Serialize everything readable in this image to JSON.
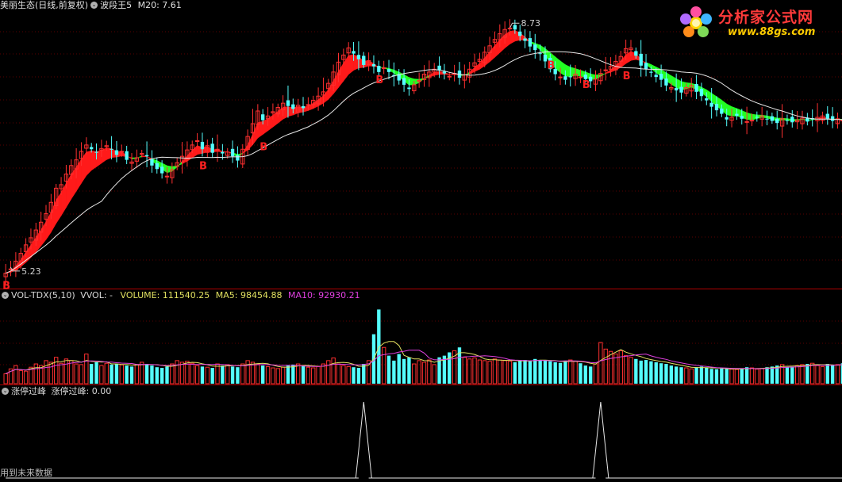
{
  "colors": {
    "bg": "#000000",
    "grid": "#5a0000",
    "up": "#ff3030",
    "down": "#54ffff",
    "band_up": "#ff1a1a",
    "band_down": "#22ff22",
    "ma": "#e8e8e8",
    "ma5": "#e0e060",
    "ma10": "#e040e0",
    "buy": "#ff2020",
    "divider": "#b00000"
  },
  "header": {
    "stock": "美丽生态",
    "period": "(日线,前复权)",
    "indicator": "波段王5",
    "ma_label": "M20: 7.61"
  },
  "price_panel": {
    "high_label": "8.73",
    "low_label": "5.23",
    "buy_marker": "B",
    "buy_indices": [
      0,
      39,
      51,
      74,
      108,
      115,
      123
    ]
  },
  "volume_panel": {
    "title": "VOL-TDX(5,10)",
    "vvol": "VVOL: -",
    "volume": "VOLUME: 111540.25",
    "ma5": "MA5: 98454.88",
    "ma10": "MA10: 92930.21"
  },
  "limit_panel": {
    "title": "涨停过峰",
    "value": "涨停过峰: 0.00",
    "peak_indices": [
      71,
      118
    ]
  },
  "footer": {
    "text": "用到未来数据"
  },
  "logo": {
    "name": "分析家公式网",
    "url": "www.88gs.com"
  },
  "chart_data": {
    "type": "candlestick",
    "low_label": 5.23,
    "high_label": 8.73,
    "closes": [
      5.2,
      5.26,
      5.37,
      5.48,
      5.6,
      5.7,
      5.81,
      5.92,
      6.04,
      6.2,
      6.4,
      6.45,
      6.6,
      6.72,
      6.8,
      6.92,
      7.01,
      6.95,
      6.9,
      6.96,
      7.0,
      6.95,
      6.87,
      6.92,
      6.8,
      6.77,
      6.83,
      6.89,
      6.85,
      6.72,
      6.67,
      6.61,
      6.57,
      6.66,
      6.76,
      6.85,
      6.94,
      7.01,
      7.07,
      6.95,
      7.0,
      6.9,
      6.95,
      6.89,
      6.91,
      6.85,
      6.79,
      6.95,
      7.13,
      7.31,
      7.49,
      7.36,
      7.42,
      7.48,
      7.54,
      7.6,
      7.56,
      7.52,
      7.57,
      7.53,
      7.58,
      7.64,
      7.7,
      7.76,
      7.88,
      8.04,
      8.18,
      8.28,
      8.38,
      8.3,
      8.22,
      8.14,
      8.2,
      8.12,
      8.04,
      8.1,
      8.04,
      7.98,
      7.92,
      7.86,
      7.8,
      7.86,
      7.92,
      8.01,
      8.04,
      8.08,
      8.06,
      8.02,
      7.98,
      8.02,
      7.96,
      8.0,
      8.08,
      8.17,
      8.22,
      8.32,
      8.41,
      8.5,
      8.58,
      8.64,
      8.66,
      8.64,
      8.55,
      8.48,
      8.4,
      8.35,
      8.3,
      8.19,
      8.08,
      8.01,
      7.97,
      7.93,
      7.97,
      8.01,
      7.97,
      7.94,
      7.91,
      7.94,
      8.02,
      8.07,
      8.12,
      8.19,
      8.26,
      8.37,
      8.38,
      8.27,
      8.13,
      8.08,
      8.03,
      7.97,
      7.93,
      7.85,
      7.82,
      7.78,
      7.75,
      7.82,
      7.85,
      7.76,
      7.7,
      7.64,
      7.55,
      7.5,
      7.45,
      7.37,
      7.4,
      7.42,
      7.38,
      7.34,
      7.36,
      7.4,
      7.42,
      7.38,
      7.35,
      7.32,
      7.38,
      7.36,
      7.33,
      7.36,
      7.39,
      7.34,
      7.37,
      7.4,
      7.42,
      7.38,
      7.35,
      7.38,
      7.36
    ],
    "volume_range": [
      0,
      250000
    ],
    "volumes": [
      30000,
      45000,
      55000,
      40000,
      38000,
      50000,
      60000,
      55000,
      70000,
      65000,
      80000,
      62000,
      75000,
      70000,
      60000,
      58000,
      90000,
      60000,
      65000,
      55000,
      62000,
      58000,
      60000,
      57000,
      55000,
      52000,
      58000,
      65000,
      60000,
      55000,
      50000,
      48000,
      52000,
      60000,
      70000,
      65000,
      68000,
      62000,
      55000,
      52000,
      50000,
      48000,
      60000,
      55000,
      58000,
      52000,
      50000,
      60000,
      70000,
      65000,
      60000,
      55000,
      52000,
      48000,
      46000,
      50000,
      55000,
      58000,
      60000,
      55000,
      50000,
      48000,
      52000,
      60000,
      70000,
      78000,
      60000,
      55000,
      52000,
      50000,
      48000,
      60000,
      70000,
      150000,
      225000,
      110000,
      85000,
      70000,
      90000,
      75000,
      80000,
      60000,
      70000,
      65000,
      72000,
      58000,
      80000,
      85000,
      95000,
      100000,
      110000,
      80000,
      75000,
      78000,
      72000,
      70000,
      68000,
      75000,
      72000,
      70000,
      68000,
      65000,
      70000,
      72000,
      68000,
      75000,
      72000,
      70000,
      68000,
      65000,
      63000,
      70000,
      72000,
      68000,
      62000,
      55000,
      52000,
      60000,
      125000,
      105000,
      98000,
      90000,
      100000,
      85000,
      80000,
      75000,
      70000,
      72000,
      68000,
      65000,
      62000,
      60000,
      55000,
      52000,
      50000,
      48000,
      45000,
      50000,
      52000,
      48000,
      45000,
      44000,
      46000,
      45000,
      44000,
      43000,
      45000,
      50000,
      48000,
      44000,
      46000,
      50000,
      52000,
      55000,
      58000,
      50000,
      52000,
      55000,
      58000,
      60000,
      62000,
      55000,
      52000,
      60000,
      56000,
      58000,
      62000,
      60000,
      57000
    ]
  }
}
